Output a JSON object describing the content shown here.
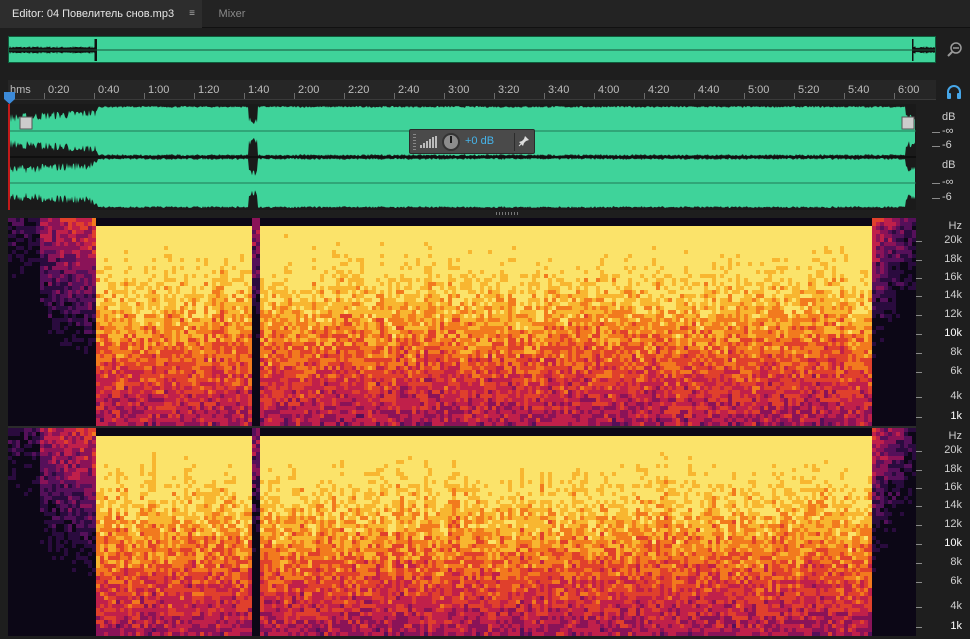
{
  "tabs": {
    "editor_label": "Editor: 04 Повелитель снов.mp3",
    "menu_glyph": "≡",
    "mixer_label": "Mixer"
  },
  "ruler": {
    "unit": "hms",
    "ticks": [
      "0:20",
      "0:40",
      "1:00",
      "1:20",
      "1:40",
      "2:00",
      "2:20",
      "2:40",
      "3:00",
      "3:20",
      "3:40",
      "4:00",
      "4:20",
      "4:40",
      "5:00",
      "5:20",
      "5:40",
      "6:00"
    ]
  },
  "waveform": {
    "db_unit": "dB",
    "channel_labels": [
      "-∞",
      "-6"
    ],
    "color": "#3fd39a"
  },
  "hud": {
    "volume": "+0 dB",
    "pin_glyph": "✗"
  },
  "spectral": {
    "hz_unit": "Hz",
    "labels": [
      "20k",
      "18k",
      "16k",
      "14k",
      "12k",
      "10k",
      "8k",
      "6k",
      "4k",
      "1k"
    ]
  },
  "icons": {
    "zoom": "zoom-out-icon",
    "headphone": "headphone-icon",
    "playhead": "playhead-icon",
    "pin": "pin-icon"
  }
}
